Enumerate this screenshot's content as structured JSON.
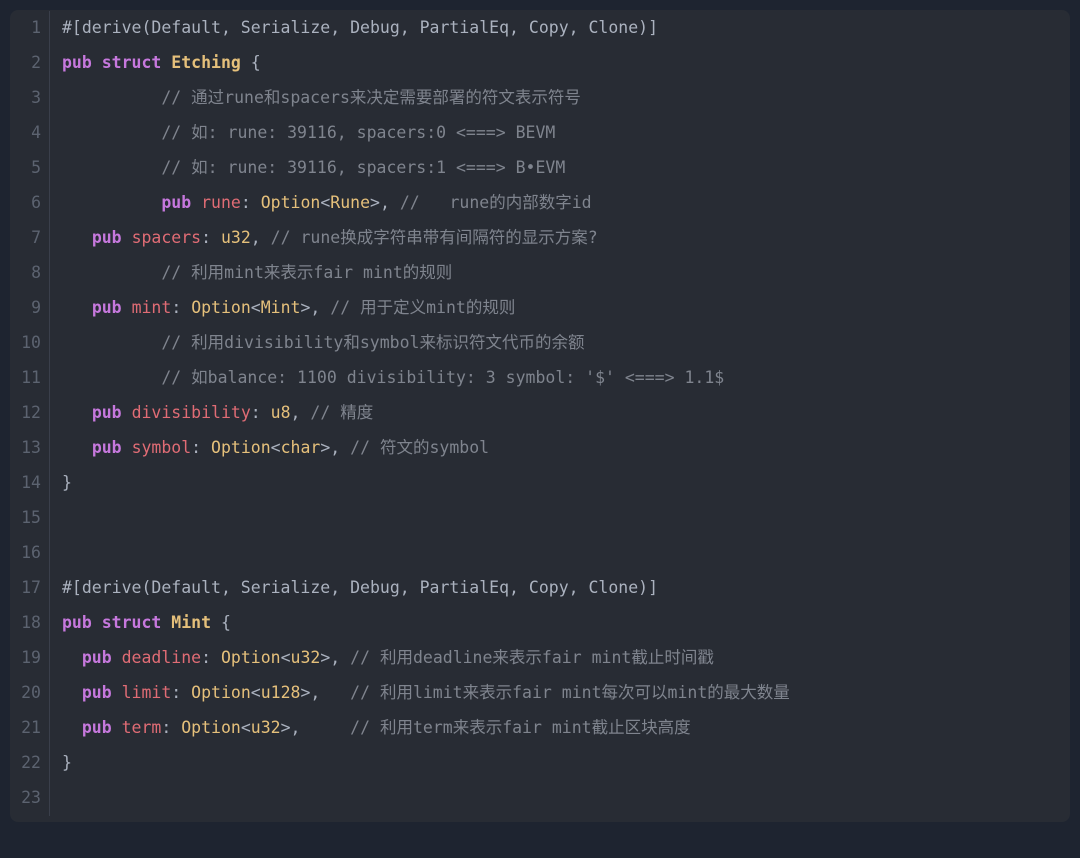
{
  "lines": [
    {
      "n": 1,
      "segments": [
        {
          "cls": "tok-attr",
          "t": "#[derive(Default, Serialize, Debug, PartialEq, Copy, Clone)]"
        }
      ]
    },
    {
      "n": 2,
      "segments": [
        {
          "cls": "tok-kw",
          "t": "pub"
        },
        {
          "cls": "tok-punct",
          "t": " "
        },
        {
          "cls": "tok-struct-kw",
          "t": "struct"
        },
        {
          "cls": "tok-punct",
          "t": " "
        },
        {
          "cls": "tok-type-bold",
          "t": "Etching"
        },
        {
          "cls": "tok-punct",
          "t": " {"
        }
      ]
    },
    {
      "n": 3,
      "segments": [
        {
          "cls": "tok-punct",
          "t": "          "
        },
        {
          "cls": "tok-comment",
          "t": "// 通过rune和spacers来决定需要部署的符文表示符号"
        }
      ]
    },
    {
      "n": 4,
      "segments": [
        {
          "cls": "tok-punct",
          "t": "          "
        },
        {
          "cls": "tok-comment",
          "t": "// 如: rune: 39116, spacers:0 <===> BEVM"
        }
      ]
    },
    {
      "n": 5,
      "segments": [
        {
          "cls": "tok-punct",
          "t": "          "
        },
        {
          "cls": "tok-comment",
          "t": "// 如: rune: 39116, spacers:1 <===> B•EVM"
        }
      ]
    },
    {
      "n": 6,
      "segments": [
        {
          "cls": "tok-punct",
          "t": "          "
        },
        {
          "cls": "tok-kw",
          "t": "pub"
        },
        {
          "cls": "tok-punct",
          "t": " "
        },
        {
          "cls": "tok-field",
          "t": "rune"
        },
        {
          "cls": "tok-punct",
          "t": ": "
        },
        {
          "cls": "tok-type",
          "t": "Option"
        },
        {
          "cls": "tok-punct",
          "t": "<"
        },
        {
          "cls": "tok-type",
          "t": "Rune"
        },
        {
          "cls": "tok-punct",
          "t": ">, "
        },
        {
          "cls": "tok-comment",
          "t": "//   rune的内部数字id"
        }
      ]
    },
    {
      "n": 7,
      "segments": [
        {
          "cls": "tok-punct",
          "t": "   "
        },
        {
          "cls": "tok-kw",
          "t": "pub"
        },
        {
          "cls": "tok-punct",
          "t": " "
        },
        {
          "cls": "tok-field",
          "t": "spacers"
        },
        {
          "cls": "tok-punct",
          "t": ": "
        },
        {
          "cls": "tok-type",
          "t": "u32"
        },
        {
          "cls": "tok-punct",
          "t": ", "
        },
        {
          "cls": "tok-comment",
          "t": "// rune换成字符串带有间隔符的显示方案?"
        }
      ]
    },
    {
      "n": 8,
      "segments": [
        {
          "cls": "tok-punct",
          "t": "          "
        },
        {
          "cls": "tok-comment",
          "t": "// 利用mint来表示fair mint的规则"
        }
      ]
    },
    {
      "n": 9,
      "segments": [
        {
          "cls": "tok-punct",
          "t": "   "
        },
        {
          "cls": "tok-kw",
          "t": "pub"
        },
        {
          "cls": "tok-punct",
          "t": " "
        },
        {
          "cls": "tok-field",
          "t": "mint"
        },
        {
          "cls": "tok-punct",
          "t": ": "
        },
        {
          "cls": "tok-type",
          "t": "Option"
        },
        {
          "cls": "tok-punct",
          "t": "<"
        },
        {
          "cls": "tok-type",
          "t": "Mint"
        },
        {
          "cls": "tok-punct",
          "t": ">, "
        },
        {
          "cls": "tok-comment",
          "t": "// 用于定义mint的规则"
        }
      ]
    },
    {
      "n": 10,
      "segments": [
        {
          "cls": "tok-punct",
          "t": "          "
        },
        {
          "cls": "tok-comment",
          "t": "// 利用divisibility和symbol来标识符文代币的余额"
        }
      ]
    },
    {
      "n": 11,
      "segments": [
        {
          "cls": "tok-punct",
          "t": "          "
        },
        {
          "cls": "tok-comment",
          "t": "// 如balance: 1100 divisibility: 3 symbol: '$' <===> 1.1$"
        }
      ]
    },
    {
      "n": 12,
      "segments": [
        {
          "cls": "tok-punct",
          "t": "   "
        },
        {
          "cls": "tok-kw",
          "t": "pub"
        },
        {
          "cls": "tok-punct",
          "t": " "
        },
        {
          "cls": "tok-field",
          "t": "divisibility"
        },
        {
          "cls": "tok-punct",
          "t": ": "
        },
        {
          "cls": "tok-type",
          "t": "u8"
        },
        {
          "cls": "tok-punct",
          "t": ", "
        },
        {
          "cls": "tok-comment",
          "t": "// 精度"
        }
      ]
    },
    {
      "n": 13,
      "segments": [
        {
          "cls": "tok-punct",
          "t": "   "
        },
        {
          "cls": "tok-kw",
          "t": "pub"
        },
        {
          "cls": "tok-punct",
          "t": " "
        },
        {
          "cls": "tok-field",
          "t": "symbol"
        },
        {
          "cls": "tok-punct",
          "t": ": "
        },
        {
          "cls": "tok-type",
          "t": "Option"
        },
        {
          "cls": "tok-punct",
          "t": "<"
        },
        {
          "cls": "tok-type",
          "t": "char"
        },
        {
          "cls": "tok-punct",
          "t": ">, "
        },
        {
          "cls": "tok-comment",
          "t": "// 符文的symbol"
        }
      ]
    },
    {
      "n": 14,
      "segments": [
        {
          "cls": "tok-punct",
          "t": "}"
        }
      ]
    },
    {
      "n": 15,
      "segments": [
        {
          "cls": "tok-punct",
          "t": ""
        }
      ]
    },
    {
      "n": 16,
      "segments": [
        {
          "cls": "tok-punct",
          "t": ""
        }
      ]
    },
    {
      "n": 17,
      "segments": [
        {
          "cls": "tok-attr",
          "t": "#[derive(Default, Serialize, Debug, PartialEq, Copy, Clone)]"
        }
      ]
    },
    {
      "n": 18,
      "segments": [
        {
          "cls": "tok-kw",
          "t": "pub"
        },
        {
          "cls": "tok-punct",
          "t": " "
        },
        {
          "cls": "tok-struct-kw",
          "t": "struct"
        },
        {
          "cls": "tok-punct",
          "t": " "
        },
        {
          "cls": "tok-type-bold",
          "t": "Mint"
        },
        {
          "cls": "tok-punct",
          "t": " {"
        }
      ]
    },
    {
      "n": 19,
      "segments": [
        {
          "cls": "tok-punct",
          "t": "  "
        },
        {
          "cls": "tok-kw",
          "t": "pub"
        },
        {
          "cls": "tok-punct",
          "t": " "
        },
        {
          "cls": "tok-field",
          "t": "deadline"
        },
        {
          "cls": "tok-punct",
          "t": ": "
        },
        {
          "cls": "tok-type",
          "t": "Option"
        },
        {
          "cls": "tok-punct",
          "t": "<"
        },
        {
          "cls": "tok-type",
          "t": "u32"
        },
        {
          "cls": "tok-punct",
          "t": ">, "
        },
        {
          "cls": "tok-comment",
          "t": "// 利用deadline来表示fair mint截止时间戳"
        }
      ]
    },
    {
      "n": 20,
      "segments": [
        {
          "cls": "tok-punct",
          "t": "  "
        },
        {
          "cls": "tok-kw",
          "t": "pub"
        },
        {
          "cls": "tok-punct",
          "t": " "
        },
        {
          "cls": "tok-field",
          "t": "limit"
        },
        {
          "cls": "tok-punct",
          "t": ": "
        },
        {
          "cls": "tok-type",
          "t": "Option"
        },
        {
          "cls": "tok-punct",
          "t": "<"
        },
        {
          "cls": "tok-type",
          "t": "u128"
        },
        {
          "cls": "tok-punct",
          "t": ">,   "
        },
        {
          "cls": "tok-comment",
          "t": "// 利用limit来表示fair mint每次可以mint的最大数量"
        }
      ]
    },
    {
      "n": 21,
      "segments": [
        {
          "cls": "tok-punct",
          "t": "  "
        },
        {
          "cls": "tok-kw",
          "t": "pub"
        },
        {
          "cls": "tok-punct",
          "t": " "
        },
        {
          "cls": "tok-field",
          "t": "term"
        },
        {
          "cls": "tok-punct",
          "t": ": "
        },
        {
          "cls": "tok-type",
          "t": "Option"
        },
        {
          "cls": "tok-punct",
          "t": "<"
        },
        {
          "cls": "tok-type",
          "t": "u32"
        },
        {
          "cls": "tok-punct",
          "t": ">,     "
        },
        {
          "cls": "tok-comment",
          "t": "// 利用term来表示fair mint截止区块高度"
        }
      ]
    },
    {
      "n": 22,
      "segments": [
        {
          "cls": "tok-punct",
          "t": "}"
        }
      ]
    },
    {
      "n": 23,
      "segments": [
        {
          "cls": "tok-punct",
          "t": ""
        }
      ]
    }
  ]
}
